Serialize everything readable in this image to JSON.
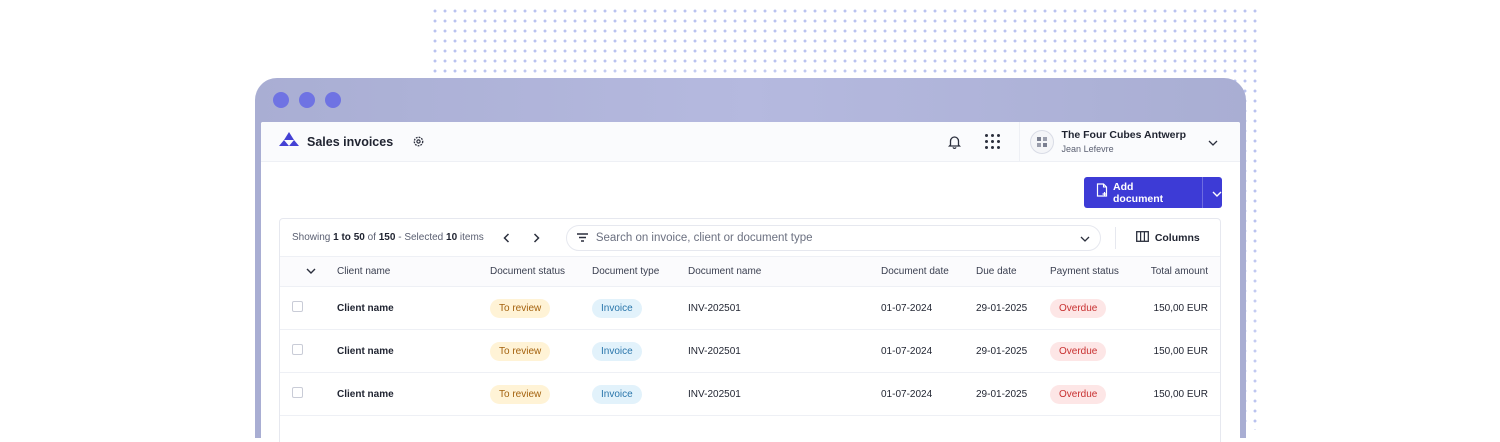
{
  "colors": {
    "accent": "#3d3bd6",
    "window_frame": "#b0b4dc",
    "traffic_light": "#6f73e3",
    "review": "#a4620e",
    "invoice": "#2a76ab",
    "overdue": "#c83030"
  },
  "header": {
    "title": "Sales invoices",
    "company_name": "The Four Cubes Antwerp",
    "user_name": "Jean Lefevre",
    "icons": [
      "logo-icon",
      "gear-icon",
      "bell-icon",
      "apps-grid-icon",
      "company-logo",
      "chevron-down-icon"
    ]
  },
  "actions": {
    "add_document_label": "Add document"
  },
  "toolbar": {
    "showing_prefix": "Showing ",
    "range": "1 to 50",
    "of_text": " of ",
    "total": "150",
    "separator": " - ",
    "selected_prefix": "Selected ",
    "selected_count": "10",
    "selected_suffix": " items",
    "search_placeholder": "Search on invoice, client or document type",
    "columns_label": "Columns"
  },
  "table": {
    "columns": [
      "Client name",
      "Document status",
      "Document type",
      "Document name",
      "Document date",
      "Due date",
      "Payment status",
      "Total amount"
    ],
    "rows": [
      {
        "client": "Client name",
        "status": "To review",
        "type": "Invoice",
        "doc_name": "INV-202501",
        "doc_date": "01-07-2024",
        "due_date": "29-01-2025",
        "payment": "Overdue",
        "amount": "150,00 EUR"
      },
      {
        "client": "Client name",
        "status": "To review",
        "type": "Invoice",
        "doc_name": "INV-202501",
        "doc_date": "01-07-2024",
        "due_date": "29-01-2025",
        "payment": "Overdue",
        "amount": "150,00 EUR"
      },
      {
        "client": "Client name",
        "status": "To review",
        "type": "Invoice",
        "doc_name": "INV-202501",
        "doc_date": "01-07-2024",
        "due_date": "29-01-2025",
        "payment": "Overdue",
        "amount": "150,00 EUR"
      }
    ]
  }
}
